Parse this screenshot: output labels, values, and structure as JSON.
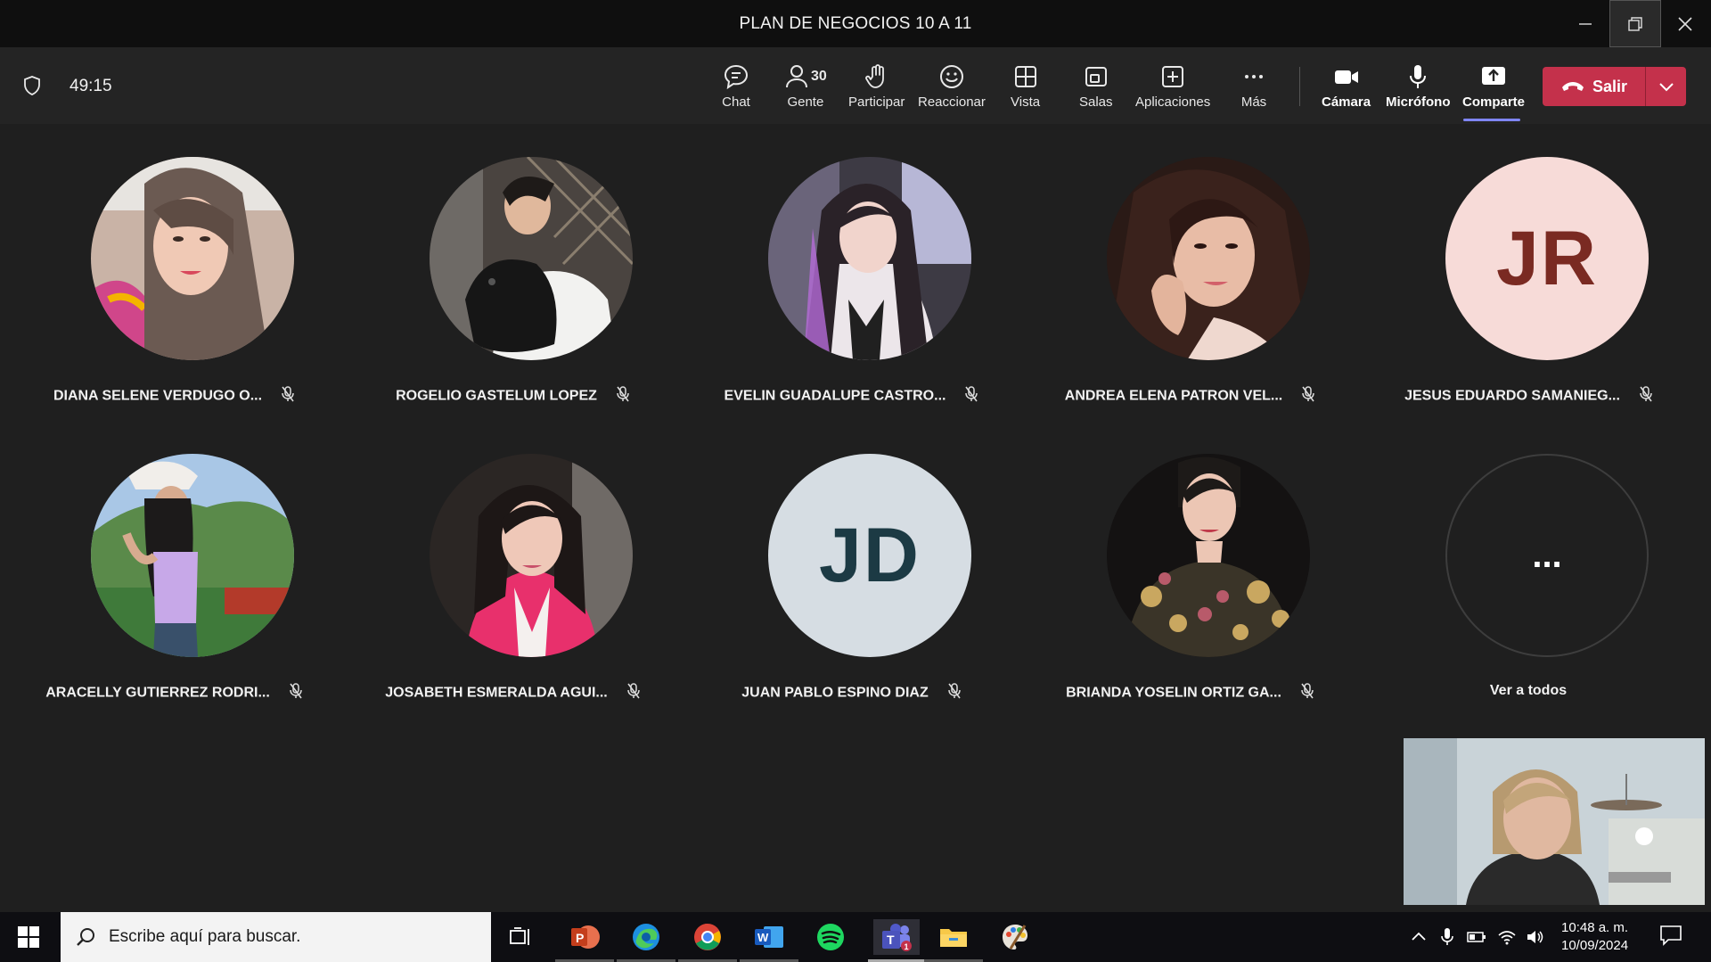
{
  "window": {
    "title": "PLAN DE NEGOCIOS 10 A 11"
  },
  "meeting": {
    "timer": "49:15"
  },
  "toolbar": {
    "chat": "Chat",
    "people": "Gente",
    "people_count": "30",
    "raise": "Participar",
    "react": "Reaccionar",
    "view": "Vista",
    "rooms": "Salas",
    "apps": "Aplicaciones",
    "more": "Más",
    "camera": "Cámara",
    "mic": "Micrófono",
    "share": "Comparte",
    "leave": "Salir"
  },
  "participants": [
    {
      "name": "DIANA SELENE VERDUGO O...",
      "avatar": "photo"
    },
    {
      "name": "ROGELIO GASTELUM LOPEZ",
      "avatar": "photo"
    },
    {
      "name": "EVELIN GUADALUPE CASTRO...",
      "avatar": "photo"
    },
    {
      "name": "ANDREA ELENA PATRON VEL...",
      "avatar": "photo"
    },
    {
      "name": "JESUS EDUARDO SAMANIEG...",
      "avatar": "initials",
      "initials": "JR",
      "bg": "#f7dbd8",
      "fg": "#7a2a22"
    },
    {
      "name": "ARACELLY GUTIERREZ RODRI...",
      "avatar": "photo"
    },
    {
      "name": "JOSABETH ESMERALDA AGUI...",
      "avatar": "photo"
    },
    {
      "name": "JUAN PABLO ESPINO DIAZ",
      "avatar": "initials",
      "initials": "JD",
      "bg": "#d6dde3",
      "fg": "#1c3a44"
    },
    {
      "name": "BRIANDA YOSELIN ORTIZ GA...",
      "avatar": "photo"
    }
  ],
  "see_all": {
    "label": "Ver a todos",
    "icon": "..."
  },
  "taskbar": {
    "search_placeholder": "Escribe aquí para buscar.",
    "time": "10:48 a. m.",
    "date": "10/09/2024",
    "apps": [
      "task-view",
      "powerpoint",
      "edge",
      "chrome",
      "word",
      "spotify",
      "teams",
      "file-explorer",
      "paint"
    ]
  },
  "colors": {
    "leave": "#c4314b",
    "accent": "#7f85f5"
  }
}
